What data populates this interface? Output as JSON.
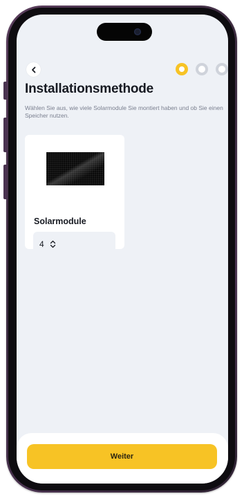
{
  "screen": {
    "title": "Installationsmethode",
    "subtitle": "Wählen Sie aus, wie viele Solarmodule Sie montiert haben und ob Sie einen Speicher nutzen."
  },
  "progress": {
    "current_step": 1,
    "total_steps": 3
  },
  "card": {
    "label": "Solarmodule",
    "image": "solar-panel-image",
    "stepper_value": "4"
  },
  "footer": {
    "button_label": "Weiter"
  },
  "colors": {
    "accent": "#f7c325",
    "background": "#eef1f6",
    "text": "#171a22",
    "muted_text": "#7a7f8f",
    "inactive_step": "#cfd3db"
  }
}
